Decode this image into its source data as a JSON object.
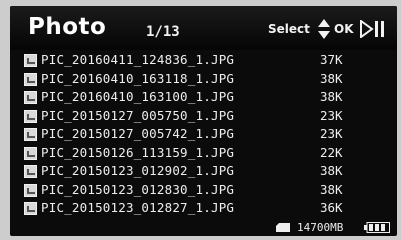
{
  "header": {
    "title": "Photo",
    "page_counter": "1/13",
    "select_hint": "Select",
    "ok_hint": "OK"
  },
  "files": [
    {
      "name": "PIC_20160411_124836_1.JPG",
      "size": "37K"
    },
    {
      "name": "PIC_20160410_163118_1.JPG",
      "size": "38K"
    },
    {
      "name": "PIC_20160410_163100_1.JPG",
      "size": "38K"
    },
    {
      "name": "PIC_20150127_005750_1.JPG",
      "size": "23K"
    },
    {
      "name": "PIC_20150127_005742_1.JPG",
      "size": "23K"
    },
    {
      "name": "PIC_20150126_113159_1.JPG",
      "size": "22K"
    },
    {
      "name": "PIC_20150123_012902_1.JPG",
      "size": "38K"
    },
    {
      "name": "PIC_20150123_012830_1.JPG",
      "size": "38K"
    },
    {
      "name": "PIC_20150123_012827_1.JPG",
      "size": "36K"
    }
  ],
  "status": {
    "free_space": "14700MB"
  },
  "icons": {
    "file": "image-file-icon",
    "select": "up-down-arrows-icon",
    "skip": "skip-forward-icon",
    "card": "sd-card-icon",
    "battery": "battery-icon"
  },
  "colors": {
    "background": "#0b0b0b",
    "text": "#eeeeee"
  }
}
